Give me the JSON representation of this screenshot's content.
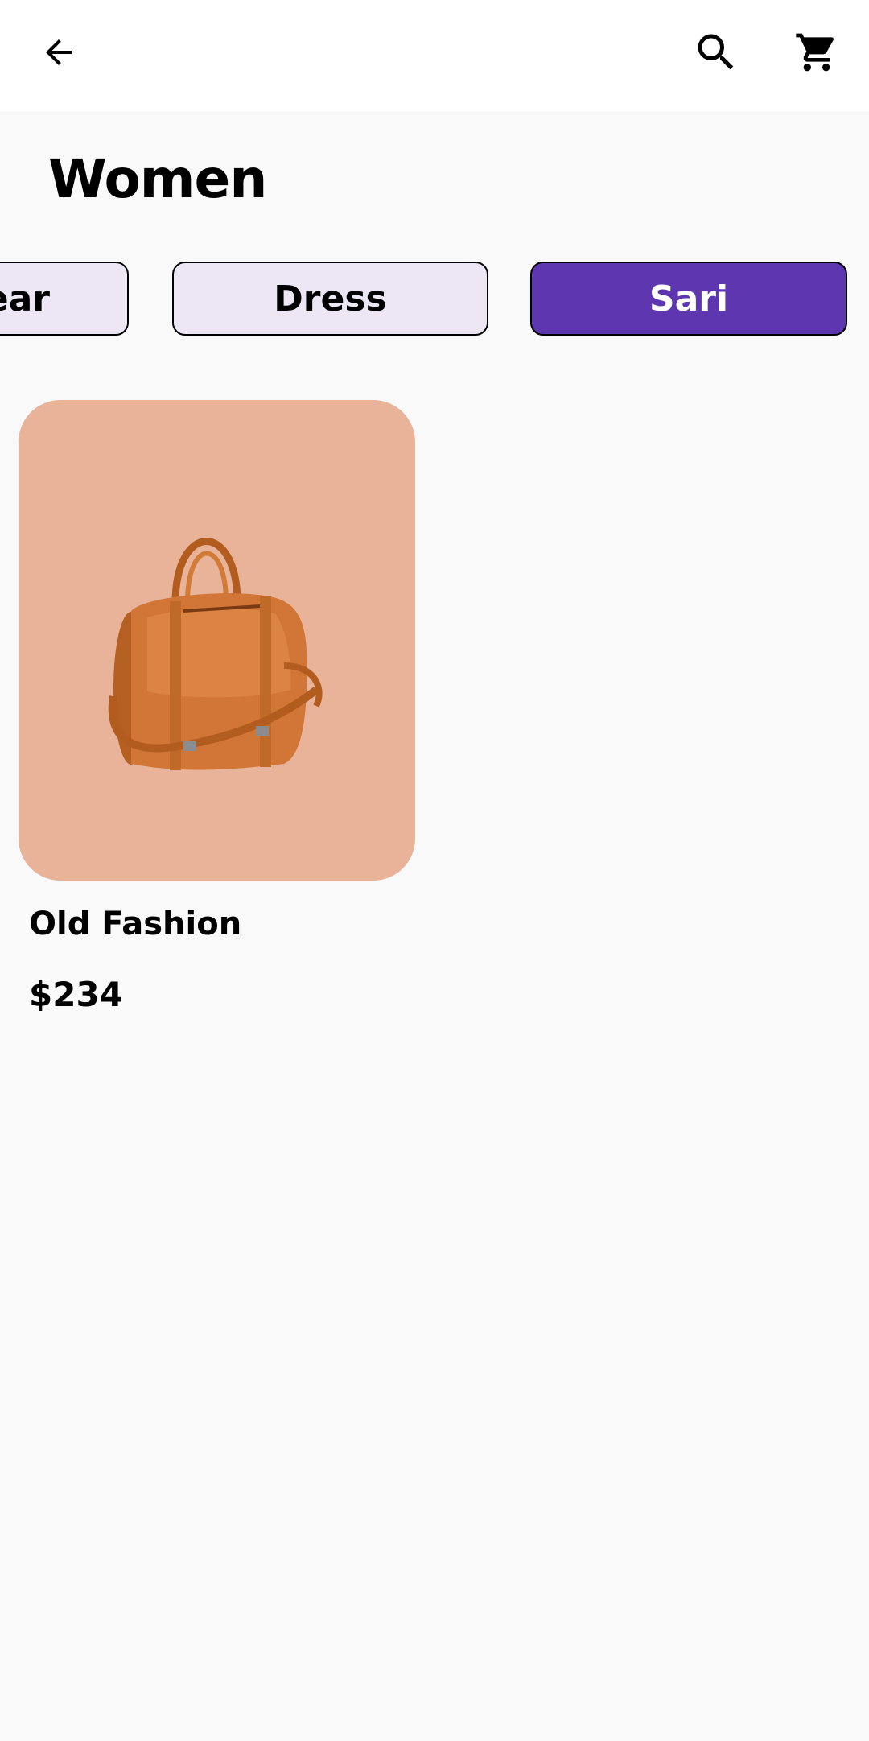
{
  "appbar": {
    "back_icon": "arrow-back-icon",
    "search_icon": "search-icon",
    "cart_icon": "shopping-cart-icon"
  },
  "page": {
    "title": "Women"
  },
  "categories": [
    {
      "label": "ear",
      "selected": false
    },
    {
      "label": "Dress",
      "selected": false
    },
    {
      "label": "Sari",
      "selected": true
    }
  ],
  "colors": {
    "accent": "#5e37b0",
    "chip_background": "#ece6f5",
    "card_background": "#e8b398",
    "page_background": "#f9f9f9"
  },
  "products": [
    {
      "name": "Old Fashion",
      "price": "$234",
      "image": "leather-duffel-bag"
    }
  ]
}
